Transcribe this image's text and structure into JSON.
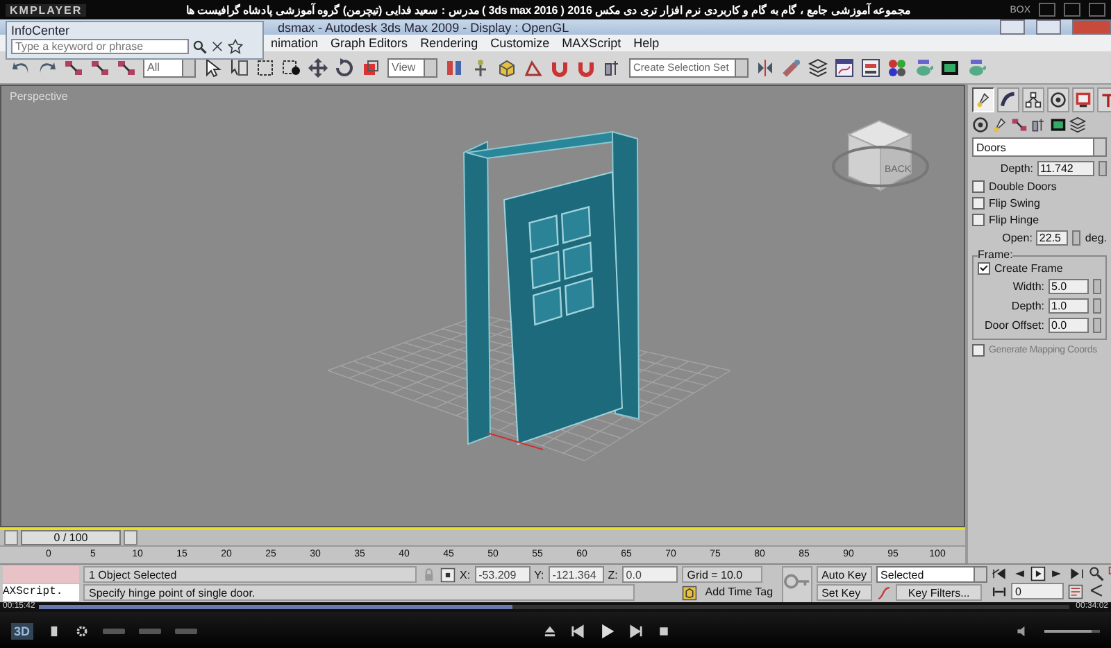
{
  "player": {
    "logo": "KMPLAYER",
    "title": "مجموعه آموزشی جامع ، گام به گام و کاربردی نرم افزار تری دی مکس 2016 ( 3ds max 2016 ) مدرس : سعید فدایی (تیچرمن) گروه آموزشی پادشاه گرافیست ها",
    "box_label": "BOX",
    "elapsed": "00:15:42",
    "total": "00:34:02",
    "progress": {
      "level": 0.46
    },
    "volume": {
      "level": 0.85
    },
    "logo_button": "3D"
  },
  "window": {
    "title": "dsmax  - Autodesk 3ds Max 2009  - Display : OpenGL"
  },
  "infocenter": {
    "title": "InfoCenter",
    "search": {
      "placeholder": "Type a keyword or phrase"
    }
  },
  "menu": [
    "nimation",
    "Graph Editors",
    "Rendering",
    "Customize",
    "MAXScript",
    "Help"
  ],
  "toolbar": {
    "filter": "All",
    "reference": "View",
    "selection_set": "Create Selection Set"
  },
  "viewport": {
    "label": "Perspective",
    "viewcube_label": "BACK"
  },
  "command_panel": {
    "tabs": [
      {
        "kind": "create",
        "selected": true
      },
      {
        "kind": "modify",
        "selected": false
      },
      {
        "kind": "hierarchy",
        "selected": false
      },
      {
        "kind": "motion",
        "selected": false
      },
      {
        "kind": "display",
        "selected": false
      },
      {
        "kind": "utilities",
        "selected": false
      }
    ],
    "category": "Doors",
    "depth_row": {
      "label": "Depth:",
      "value": "11.742"
    },
    "options": [
      {
        "label": "Double Doors",
        "checked": false
      },
      {
        "label": "Flip Swing",
        "checked": false
      },
      {
        "label": "Flip Hinge",
        "checked": false
      }
    ],
    "open": {
      "label": "Open:",
      "value": "22.5",
      "unit": "deg."
    },
    "frame": {
      "title": "Frame:",
      "create": {
        "label": "Create Frame",
        "checked": true
      },
      "fields": [
        {
          "label": "Width:",
          "value": "5.0"
        },
        {
          "label": "Depth:",
          "value": "1.0"
        },
        {
          "label": "Door Offset:",
          "value": "0.0"
        }
      ]
    },
    "mapping": {
      "label": "Generate Mapping Coords",
      "checked": false
    }
  },
  "timeline": {
    "slider": "0 / 100",
    "ticks": [
      "0",
      "5",
      "10",
      "15",
      "20",
      "25",
      "30",
      "35",
      "40",
      "45",
      "50",
      "55",
      "60",
      "65",
      "70",
      "75",
      "80",
      "85",
      "90",
      "95",
      "100"
    ]
  },
  "status": {
    "maxscript": "AXScript.",
    "selection": "1 Object Selected",
    "prompt": "Specify hinge point of single door.",
    "coords": [
      {
        "label": "X:",
        "value": "-53.209"
      },
      {
        "label": "Y:",
        "value": "-121.364"
      },
      {
        "label": "Z:",
        "value": "0.0"
      }
    ],
    "grid": "Grid = 10.0",
    "time_tag": "Add Time Tag"
  },
  "animation": {
    "auto_key": "Auto Key",
    "set_key": "Set Key",
    "key_mode": "Selected",
    "key_filters": "Key Filters...",
    "frame": "0"
  }
}
